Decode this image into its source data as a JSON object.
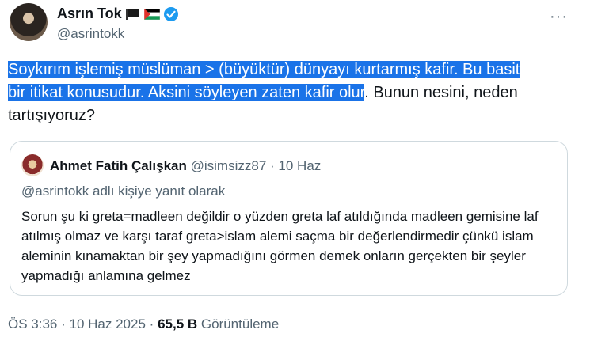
{
  "author": {
    "display_name": "Asrın Tok",
    "handle": "@asrintokk",
    "flags": [
      "black-flag-icon",
      "palestine-flag-icon"
    ],
    "verified": true
  },
  "more_label": "···",
  "tweet": {
    "highlighted_line1": "Soykırım işlemiş müslüman > (büyüktür) dünyayı kurtarmış kafir. Bu basit",
    "highlighted_line2": "bir itikat konusudur. Aksini söyleyen zaten kafir olur",
    "rest": ". Bunun nesini, neden tartışıyoruz?"
  },
  "quote": {
    "display_name": "Ahmet Fatih Çalışkan",
    "handle": "@isimsizz87",
    "separator": "·",
    "date": "10 Haz",
    "reply_context": "@asrintokk adlı kişiye yanıt olarak",
    "body": "Sorun şu ki greta=madleen değildir o yüzden greta laf atıldığında madleen gemisine laf atılmış olmaz ve karşı taraf greta>islam alemi saçma bir değerlendirmedir çünkü islam aleminin kınamaktan bir şey yapmadığını görmen demek onların gerçekten bir şeyler yapmadığı anlamına gelmez"
  },
  "footer": {
    "time": "ÖS 3:36",
    "sep1": "·",
    "date": "10 Haz 2025",
    "sep2": "·",
    "views_count": "65,5 B",
    "views_label": "Görüntüleme"
  },
  "colors": {
    "highlight": "#1a73e8",
    "verified": "#1d9bf0",
    "secondary_text": "#536471",
    "border": "#cfd9de"
  }
}
